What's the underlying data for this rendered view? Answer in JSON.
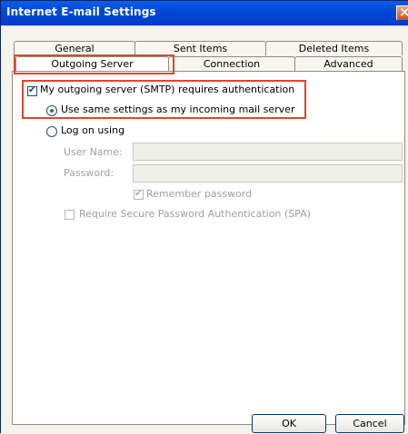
{
  "window": {
    "title": "Internet E-mail Settings"
  },
  "tabs": {
    "row1": [
      {
        "label": "General"
      },
      {
        "label": "Sent Items"
      },
      {
        "label": "Deleted Items"
      }
    ],
    "row2": [
      {
        "label": "Outgoing Server",
        "selected": true
      },
      {
        "label": "Connection"
      },
      {
        "label": "Advanced"
      }
    ]
  },
  "outgoing": {
    "auth_label": "My outgoing server (SMTP) requires authentication",
    "auth_checked": true,
    "radio_same_label": "Use same settings as my incoming mail server",
    "radio_same_selected": true,
    "radio_logon_label": "Log on using",
    "radio_logon_selected": false,
    "username_label": "User Name:",
    "username_value": "",
    "password_label": "Password:",
    "password_value": "",
    "remember_label": "Remember password",
    "remember_checked": true,
    "spa_label": "Require Secure Password Authentication (SPA)",
    "spa_checked": false
  },
  "buttons": {
    "ok": "OK",
    "cancel": "Cancel"
  },
  "colors": {
    "highlight": "#e0452f",
    "title_bar": "#0a52e0",
    "disabled_text": "#9f9f9f"
  }
}
